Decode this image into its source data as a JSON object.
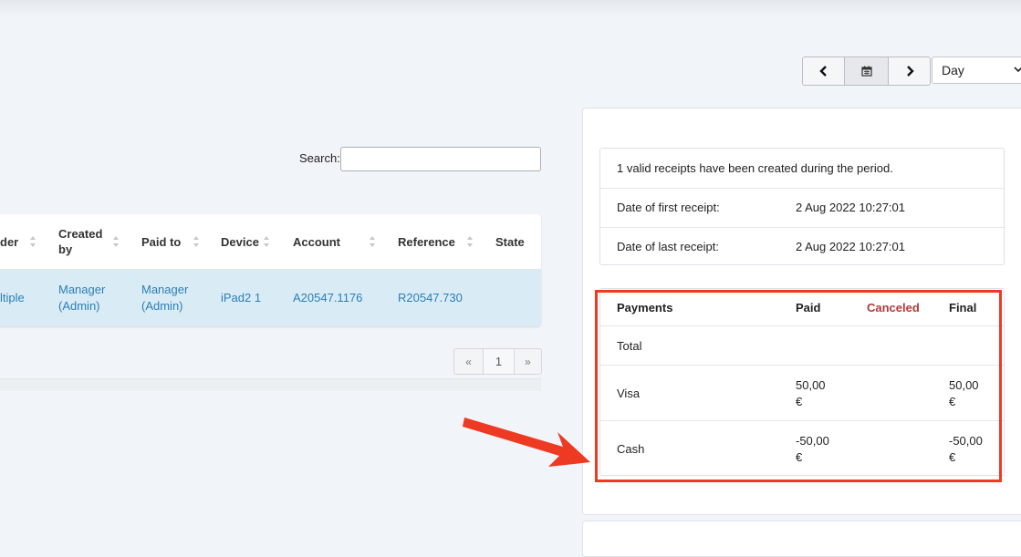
{
  "nav": {
    "prev_icon": "chevron-left-icon",
    "calendar_icon": "calendar-icon",
    "next_icon": "chevron-right-icon",
    "period_value": "Day"
  },
  "search": {
    "label": "Search:",
    "value": ""
  },
  "table": {
    "headers": [
      "der",
      "Created by",
      "Paid to",
      "Device",
      "Account",
      "Reference",
      "State"
    ],
    "rows": [
      {
        "order": "ltiple",
        "created_by": "Manager (Admin)",
        "paid_to": "Manager (Admin)",
        "device": "iPad2 1",
        "account": "A20547.1176",
        "reference": "R20547.730",
        "state": ""
      }
    ]
  },
  "pager": {
    "prev": "«",
    "current": "1",
    "next": "»"
  },
  "summary": {
    "valid_text": "1 valid receipts have been created during the period.",
    "first_label": "Date of first receipt:",
    "first_value": "2 Aug 2022 10:27:01",
    "last_label": "Date of last receipt:",
    "last_value": "2 Aug 2022 10:27:01"
  },
  "payments": {
    "headers": {
      "payments": "Payments",
      "paid": "Paid",
      "canceled": "Canceled",
      "final": "Final"
    },
    "rows": [
      {
        "label": "Total",
        "paid": "",
        "paid_unit": "",
        "final": "",
        "final_unit": ""
      },
      {
        "label": "Visa",
        "paid": "50,00",
        "paid_unit": "€",
        "final": "50,00",
        "final_unit": "€"
      },
      {
        "label": "Cash",
        "paid": "-50,00",
        "paid_unit": "€",
        "final": "-50,00",
        "final_unit": "€"
      }
    ]
  },
  "colors": {
    "accent_link": "#2a7fb8",
    "highlight": "#ee3a23",
    "canceled": "#b23a3a",
    "row_selected": "#d9ebf5"
  }
}
